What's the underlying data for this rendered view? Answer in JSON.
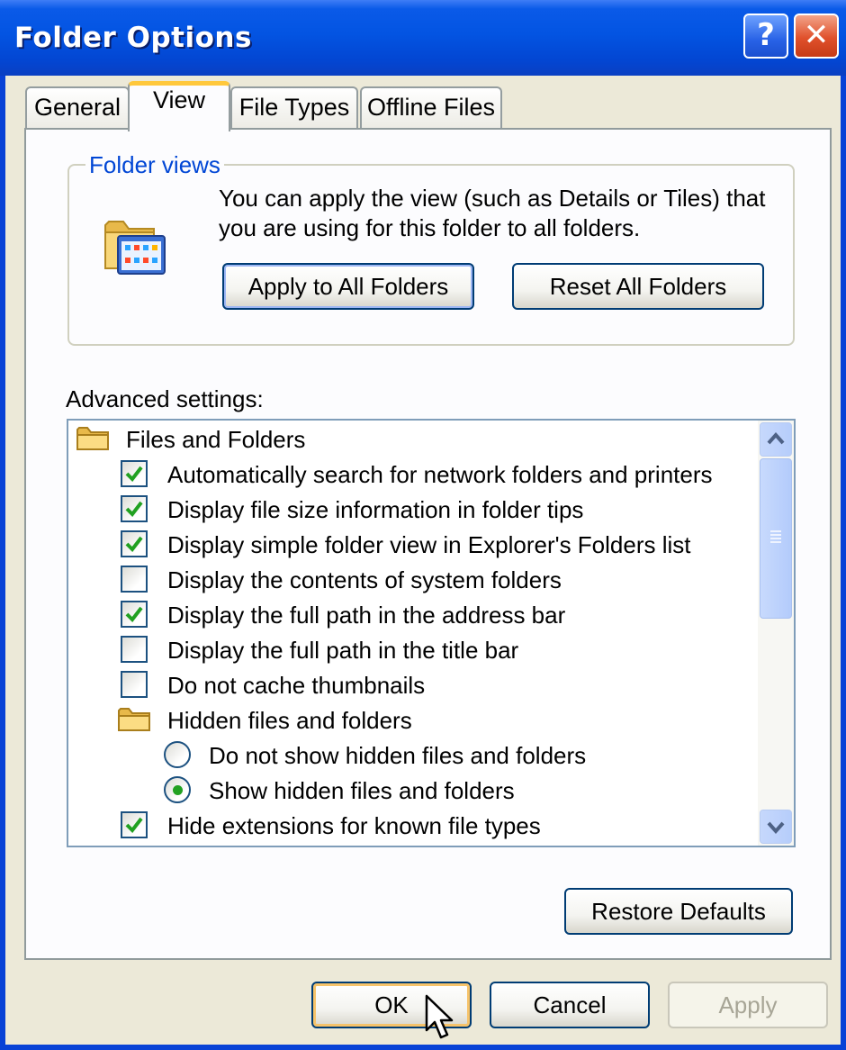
{
  "window": {
    "title": "Folder Options",
    "help_glyph": "?",
    "close_glyph": "✕"
  },
  "tabs": [
    {
      "label": "General",
      "active": false
    },
    {
      "label": "View",
      "active": true
    },
    {
      "label": "File Types",
      "active": false
    },
    {
      "label": "Offline Files",
      "active": false
    }
  ],
  "folder_views": {
    "legend": "Folder views",
    "description": "You can apply the view (such as Details or Tiles) that you are using for this folder to all folders.",
    "apply_all_label": "Apply to All Folders",
    "reset_all_label": "Reset All Folders"
  },
  "advanced": {
    "label": "Advanced settings:",
    "items": [
      {
        "kind": "folder",
        "label": "Files and Folders"
      },
      {
        "kind": "checkbox",
        "checked": true,
        "label": "Automatically search for network folders and printers"
      },
      {
        "kind": "checkbox",
        "checked": true,
        "label": "Display file size information in folder tips"
      },
      {
        "kind": "checkbox",
        "checked": true,
        "label": "Display simple folder view in Explorer's Folders list"
      },
      {
        "kind": "checkbox",
        "checked": false,
        "label": "Display the contents of system folders"
      },
      {
        "kind": "checkbox",
        "checked": true,
        "label": "Display the full path in the address bar"
      },
      {
        "kind": "checkbox",
        "checked": false,
        "label": "Display the full path in the title bar"
      },
      {
        "kind": "checkbox",
        "checked": false,
        "label": "Do not cache thumbnails"
      },
      {
        "kind": "folder",
        "label": "Hidden files and folders"
      },
      {
        "kind": "radio",
        "checked": false,
        "label": "Do not show hidden files and folders"
      },
      {
        "kind": "radio",
        "checked": true,
        "label": "Show hidden files and folders"
      },
      {
        "kind": "checkbox",
        "checked": true,
        "label": "Hide extensions for known file types"
      }
    ]
  },
  "restore_defaults_label": "Restore Defaults",
  "footer": {
    "ok_label": "OK",
    "cancel_label": "Cancel",
    "apply_label": "Apply"
  },
  "colors": {
    "title_bar": "#0354e2",
    "accent_check": "#21a121",
    "legend_text": "#0046d5",
    "tab_highlight": "#ffc83c"
  }
}
